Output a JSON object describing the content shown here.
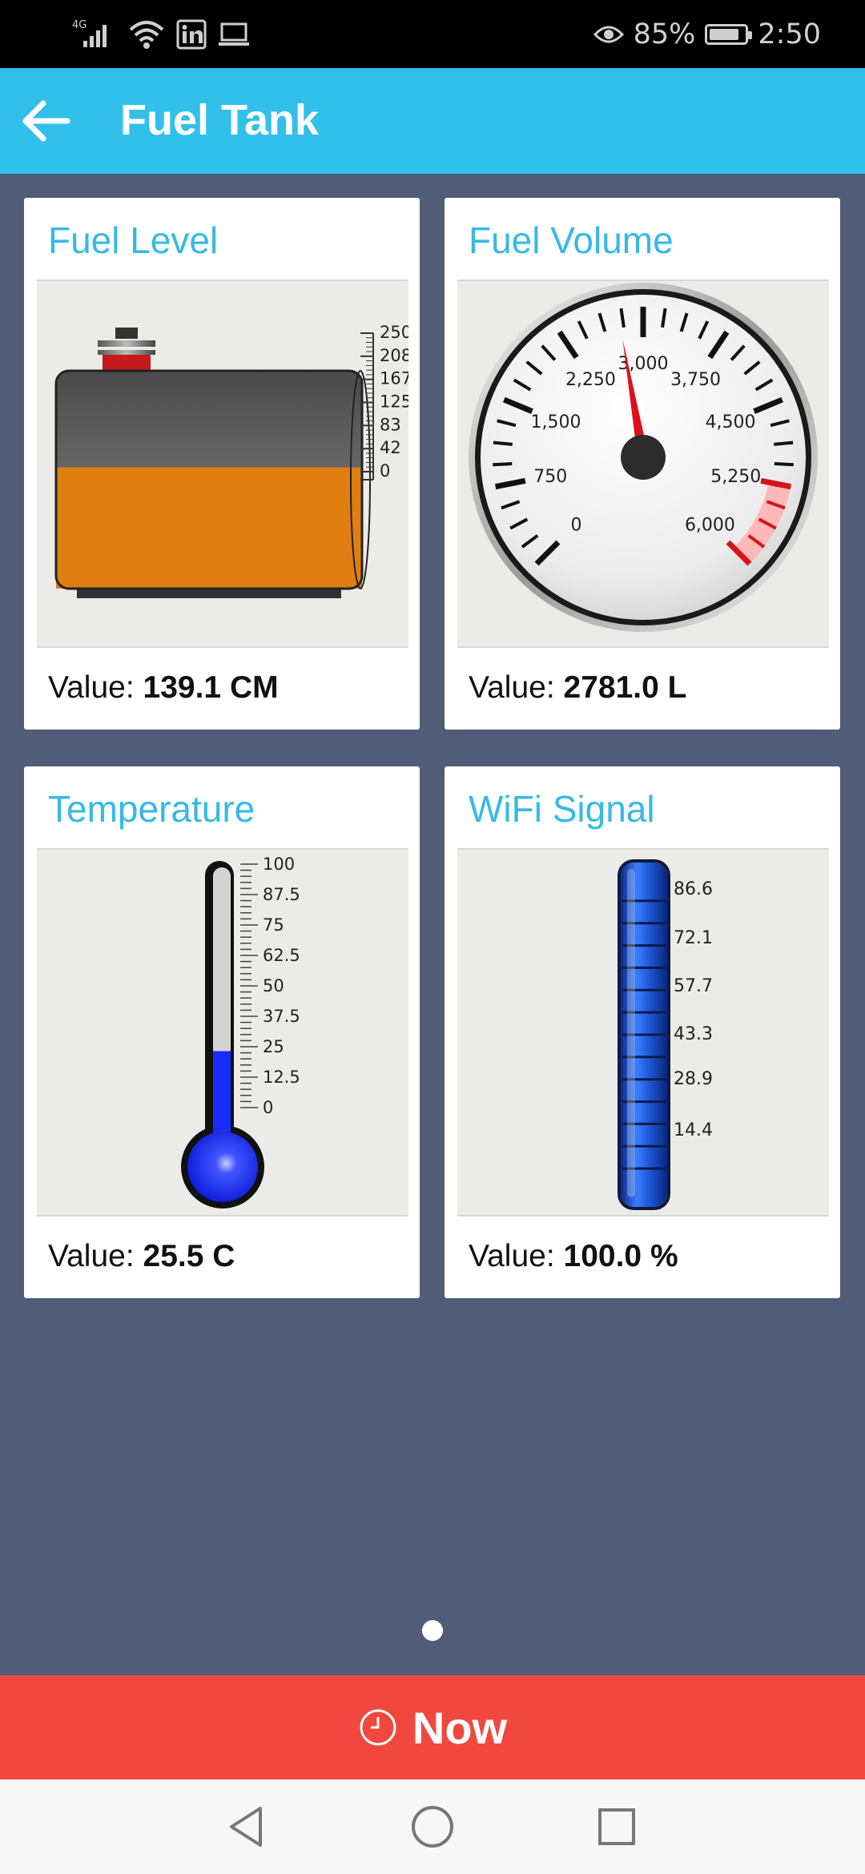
{
  "status_bar": {
    "network": "4G",
    "battery_percent": "85%",
    "battery_level": 0.85,
    "time": "2:50",
    "icons": [
      "signal-icon",
      "wifi-icon",
      "linkedin-icon",
      "laptop-icon",
      "eye-icon",
      "battery-icon"
    ]
  },
  "app_bar": {
    "title": "Fuel Tank",
    "back_icon": "arrow-left-icon"
  },
  "cards": [
    {
      "title": "Fuel Level",
      "value_label": "Value: ",
      "value": "139.1 CM",
      "gauge": {
        "type": "tank",
        "min": 0,
        "max": 250,
        "current": 139.1,
        "scale_labels": [
          "250",
          "208",
          "167",
          "125",
          "83",
          "42",
          "0"
        ],
        "fill_color": "#e07e12"
      }
    },
    {
      "title": "Fuel Volume",
      "value_label": "Value: ",
      "value": "2781.0 L",
      "gauge": {
        "type": "dial",
        "min": 0,
        "max": 6000,
        "current": 2781,
        "scale_labels": [
          "0",
          "750",
          "1,500",
          "2,250",
          "3,000",
          "3,750",
          "4,500",
          "5,250",
          "6,000"
        ],
        "red_zone_from": 5250
      }
    },
    {
      "title": "Temperature",
      "value_label": "Value: ",
      "value": "25.5 C",
      "gauge": {
        "type": "thermometer",
        "min": 0,
        "max": 100,
        "current": 25.5,
        "scale_labels": [
          "100",
          "87.5",
          "75",
          "62.5",
          "50",
          "37.5",
          "25",
          "12.5",
          "0"
        ],
        "fill_color": "#1a2bff"
      }
    },
    {
      "title": "WiFi Signal",
      "value_label": "Value: ",
      "value": "100.0 %",
      "gauge": {
        "type": "bar",
        "min": 0,
        "max": 100,
        "current": 100,
        "scale_labels": [
          "86.6",
          "72.1",
          "57.7",
          "43.3",
          "28.9",
          "14.4"
        ],
        "fill_color": "#1a56d6"
      }
    }
  ],
  "pager": {
    "pages": 1,
    "active": 1
  },
  "now_button": {
    "label": "Now",
    "icon": "clock-icon"
  },
  "nav_bar": {
    "buttons": [
      "back-triangle-icon",
      "home-circle-icon",
      "recents-square-icon"
    ]
  }
}
